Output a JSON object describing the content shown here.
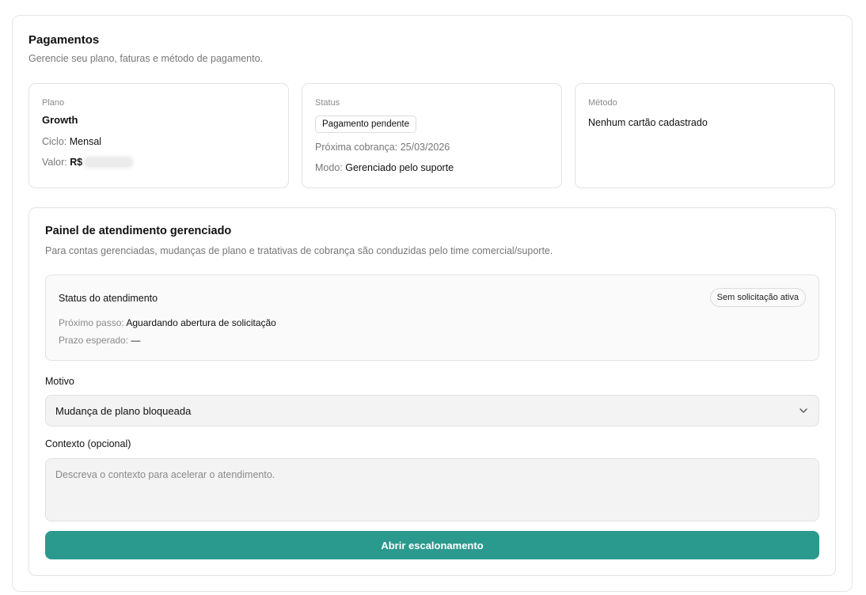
{
  "header": {
    "title": "Pagamentos",
    "subtitle": "Gerencie seu plano, faturas e método de pagamento."
  },
  "plan_card": {
    "label": "Plano",
    "name": "Growth",
    "cycle_label": "Ciclo:",
    "cycle_value": "Mensal",
    "value_label": "Valor:",
    "value_currency": "R$"
  },
  "status_card": {
    "label": "Status",
    "badge": "Pagamento pendente",
    "next_charge_label": "Próxima cobrança:",
    "next_charge_value": "25/03/2026",
    "mode_label": "Modo:",
    "mode_value": "Gerenciado pelo suporte"
  },
  "method_card": {
    "label": "Método",
    "value": "Nenhum cartão cadastrado"
  },
  "panel": {
    "title": "Painel de atendimento gerenciado",
    "subtitle": "Para contas gerenciadas, mudanças de plano e tratativas de cobrança são conduzidas pelo time comercial/suporte.",
    "status_box": {
      "title": "Status do atendimento",
      "badge": "Sem solicitação ativa",
      "next_step_label": "Próximo passo:",
      "next_step_value": "Aguardando abertura de solicitação",
      "deadline_label": "Prazo esperado:",
      "deadline_value": "—"
    },
    "reason": {
      "label": "Motivo",
      "selected": "Mudança de plano bloqueada",
      "icon": "chevron-down-icon"
    },
    "context": {
      "label": "Contexto (opcional)",
      "placeholder": "Descreva o contexto para acelerar o atendimento.",
      "value": ""
    },
    "submit_label": "Abrir escalonamento"
  },
  "colors": {
    "accent": "#2b9a8e",
    "muted_text": "#777777",
    "border": "#e3e3e3",
    "input_bg": "#f3f3f3"
  }
}
